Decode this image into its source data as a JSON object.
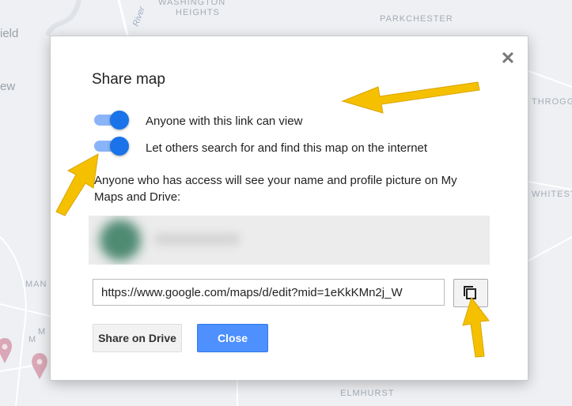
{
  "map_background": {
    "labels": [
      "WASHINGTON",
      "HEIGHTS",
      "PARKCHESTER",
      "THROGGS",
      "WHITESTO",
      "ELMHURST",
      "River",
      "ield",
      "ew",
      "MAN",
      "M",
      "M"
    ]
  },
  "dialog": {
    "title": "Share map",
    "close_icon": "close-icon",
    "toggles": [
      {
        "label": "Anyone with this link can view",
        "on": true
      },
      {
        "label": "Let others search for and find this map on the internet",
        "on": true
      }
    ],
    "info_text": "Anyone who has access will see your name and profile picture on My Maps and Drive:",
    "link_value": "https://www.google.com/maps/d/edit?mid=1eKkKMn2j_W",
    "copy_icon": "copy-icon",
    "buttons": {
      "share_drive": "Share on Drive",
      "close": "Close"
    }
  },
  "colors": {
    "toggle_on": "#1a73e8",
    "toggle_track": "#8ab4f8",
    "close_button": "#4d90fe",
    "annotation_arrow": "#f5c000",
    "map_pin": "#d9a7b6"
  }
}
